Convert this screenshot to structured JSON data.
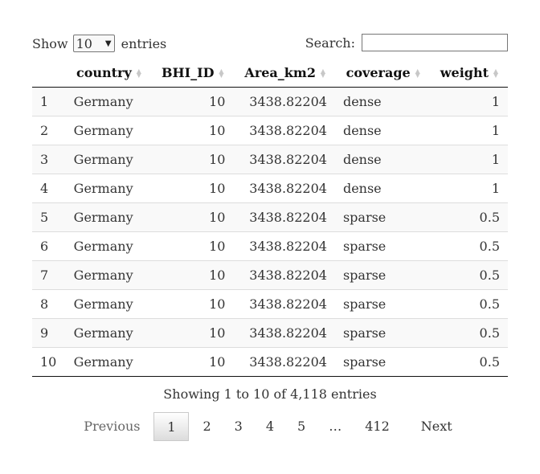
{
  "length": {
    "show_label": "Show",
    "value": "10",
    "entries_label": "entries"
  },
  "search": {
    "label": "Search:",
    "value": ""
  },
  "table": {
    "headers": [
      "",
      "country",
      "BHI_ID",
      "Area_km2",
      "coverage",
      "weight"
    ],
    "rows": [
      [
        "1",
        "Germany",
        "10",
        "3438.82204",
        "dense",
        "1"
      ],
      [
        "2",
        "Germany",
        "10",
        "3438.82204",
        "dense",
        "1"
      ],
      [
        "3",
        "Germany",
        "10",
        "3438.82204",
        "dense",
        "1"
      ],
      [
        "4",
        "Germany",
        "10",
        "3438.82204",
        "dense",
        "1"
      ],
      [
        "5",
        "Germany",
        "10",
        "3438.82204",
        "sparse",
        "0.5"
      ],
      [
        "6",
        "Germany",
        "10",
        "3438.82204",
        "sparse",
        "0.5"
      ],
      [
        "7",
        "Germany",
        "10",
        "3438.82204",
        "sparse",
        "0.5"
      ],
      [
        "8",
        "Germany",
        "10",
        "3438.82204",
        "sparse",
        "0.5"
      ],
      [
        "9",
        "Germany",
        "10",
        "3438.82204",
        "sparse",
        "0.5"
      ],
      [
        "10",
        "Germany",
        "10",
        "3438.82204",
        "sparse",
        "0.5"
      ]
    ]
  },
  "info": "Showing 1 to 10 of 4,118 entries",
  "pagination": {
    "previous": "Previous",
    "pages": [
      "1",
      "2",
      "3",
      "4",
      "5",
      "…",
      "412"
    ],
    "current": "1",
    "next": "Next"
  }
}
